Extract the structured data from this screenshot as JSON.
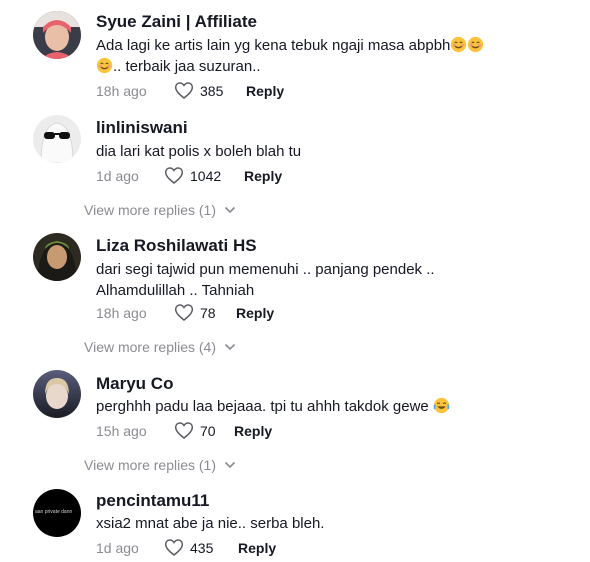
{
  "comments": [
    {
      "username": "Syue  Zaini | Affiliate",
      "text_line1": "Ada lagi ke artis lain yg kena tebuk ngaji masa abpbh",
      "text_line2": ".. terbaik jaa suzuran..",
      "time": "18h ago",
      "likes": "385",
      "reply": "Reply",
      "emoji": "smiling-face"
    },
    {
      "username": "linliniswani",
      "text": "dia lari kat polis x boleh blah tu",
      "time": "1d ago",
      "likes": "1042",
      "reply": "Reply",
      "view_more": "View more replies (1)"
    },
    {
      "username": "Liza Roshilawati HS",
      "text_line1": "dari segi tajwid pun memenuhi .. panjang pendek ..",
      "text_line2": "Alhamdulillah .. Tahniah",
      "time": "18h ago",
      "likes": "78",
      "reply": "Reply",
      "view_more": "View more replies (4)"
    },
    {
      "username": "Maryu Co",
      "text": "perghhh padu laa bejaaa. tpi tu ahhh takdok gewe",
      "time": "15h ago",
      "likes": "70",
      "reply": "Reply",
      "view_more": "View more replies (1)",
      "emoji": "tears-of-joy"
    },
    {
      "username": "pencintamu11",
      "text": "xsia2 mnat abe ja nie.. serba bleh.",
      "time": "1d ago",
      "likes": "435",
      "reply": "Reply",
      "avatar_text": "aan private dann"
    }
  ],
  "colors": {
    "primary_text": "#161823",
    "secondary_text": "#8a8b91",
    "background": "#ffffff"
  },
  "icons": [
    "heart-outline-icon",
    "chevron-down-icon",
    "smiling-face-emoji",
    "tears-of-joy-emoji"
  ]
}
